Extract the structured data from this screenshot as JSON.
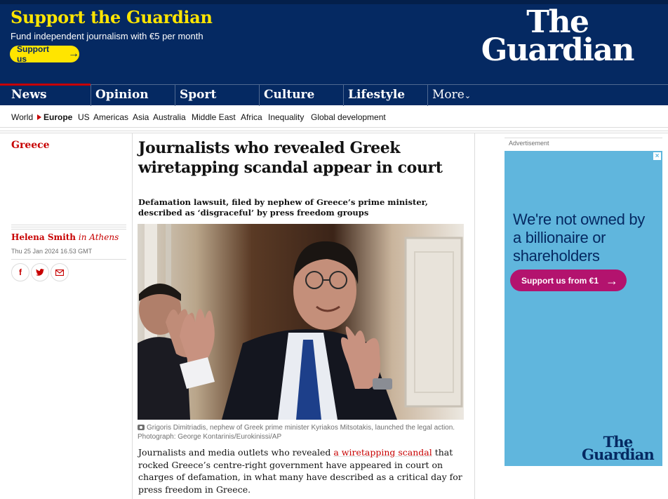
{
  "header": {
    "support_title": "Support the Guardian",
    "support_sub": "Fund independent journalism with €5 per month",
    "support_button": "Support us",
    "logo_line1": "The",
    "logo_line2": "Guardian"
  },
  "nav": {
    "items": [
      "News",
      "Opinion",
      "Sport",
      "Culture",
      "Lifestyle"
    ],
    "more": "More"
  },
  "subnav": {
    "items": [
      "World",
      "Europe",
      "US",
      "Americas",
      "Asia",
      "Australia",
      "Middle East",
      "Africa",
      "Inequality",
      "Global development"
    ],
    "active": "Europe"
  },
  "article": {
    "section": "Greece",
    "headline": "Journalists who revealed Greek wiretapping scandal appear in court",
    "standfirst": "Defamation lawsuit, filed by nephew of Greece’s prime minister, described as ‘disgraceful’ by press freedom groups",
    "author": "Helena Smith",
    "location": "in Athens",
    "date": "Thu 25 Jan 2024 16.53 GMT",
    "caption": "Grigoris Dimitriadis, nephew of Greek prime minister Kyriakos Mitsotakis, launched the legal action. Photograph: George Kontarinis/Eurokinissi/AP",
    "body_intro": "Journalists and media outlets who revealed",
    "body_link": "a wiretapping scandal",
    "body_rest": "that rocked Greece’s centre-right government have appeared in court on charges of defamation, in what many have described as a critical day for press freedom in Greece."
  },
  "ad": {
    "label": "Advertisement",
    "text": "We're not owned by a billionaire or shareholders",
    "button": "Support us from €1",
    "logo_line1": "The",
    "logo_line2": "Guardian"
  },
  "colors": {
    "brand_blue": "#052962",
    "support_yellow": "#ffe500",
    "news_red": "#c70000",
    "ad_bg": "#60b6dd",
    "ad_button": "#b3136e"
  },
  "icons": [
    "camera-icon",
    "facebook-icon",
    "twitter-icon",
    "email-icon",
    "arrow-right-icon",
    "chevron-down-icon",
    "close-icon"
  ]
}
